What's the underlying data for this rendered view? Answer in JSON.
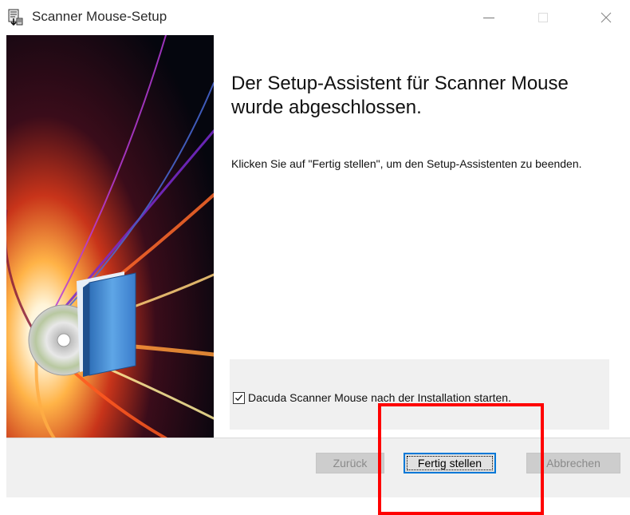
{
  "window": {
    "title": "Scanner Mouse-Setup"
  },
  "titlebar_buttons": {
    "minimize_icon": "minimize-icon",
    "maximize_icon": "maximize-icon",
    "close_icon": "close-icon"
  },
  "content": {
    "heading": "Der Setup-Assistent für Scanner Mouse wurde abgeschlossen.",
    "body": "Klicken Sie auf \"Fertig stellen\", um den Setup-Assistenten zu beenden."
  },
  "checkbox": {
    "label": "Dacuda Scanner Mouse nach der Installation starten.",
    "checked": true
  },
  "buttons": {
    "back": "Zurück",
    "finish": "Fertig stellen",
    "cancel": "Abbrechen"
  },
  "colors": {
    "accent": "#0078d7",
    "highlight": "#ff0000",
    "panel_bg": "#f0f0f0"
  }
}
